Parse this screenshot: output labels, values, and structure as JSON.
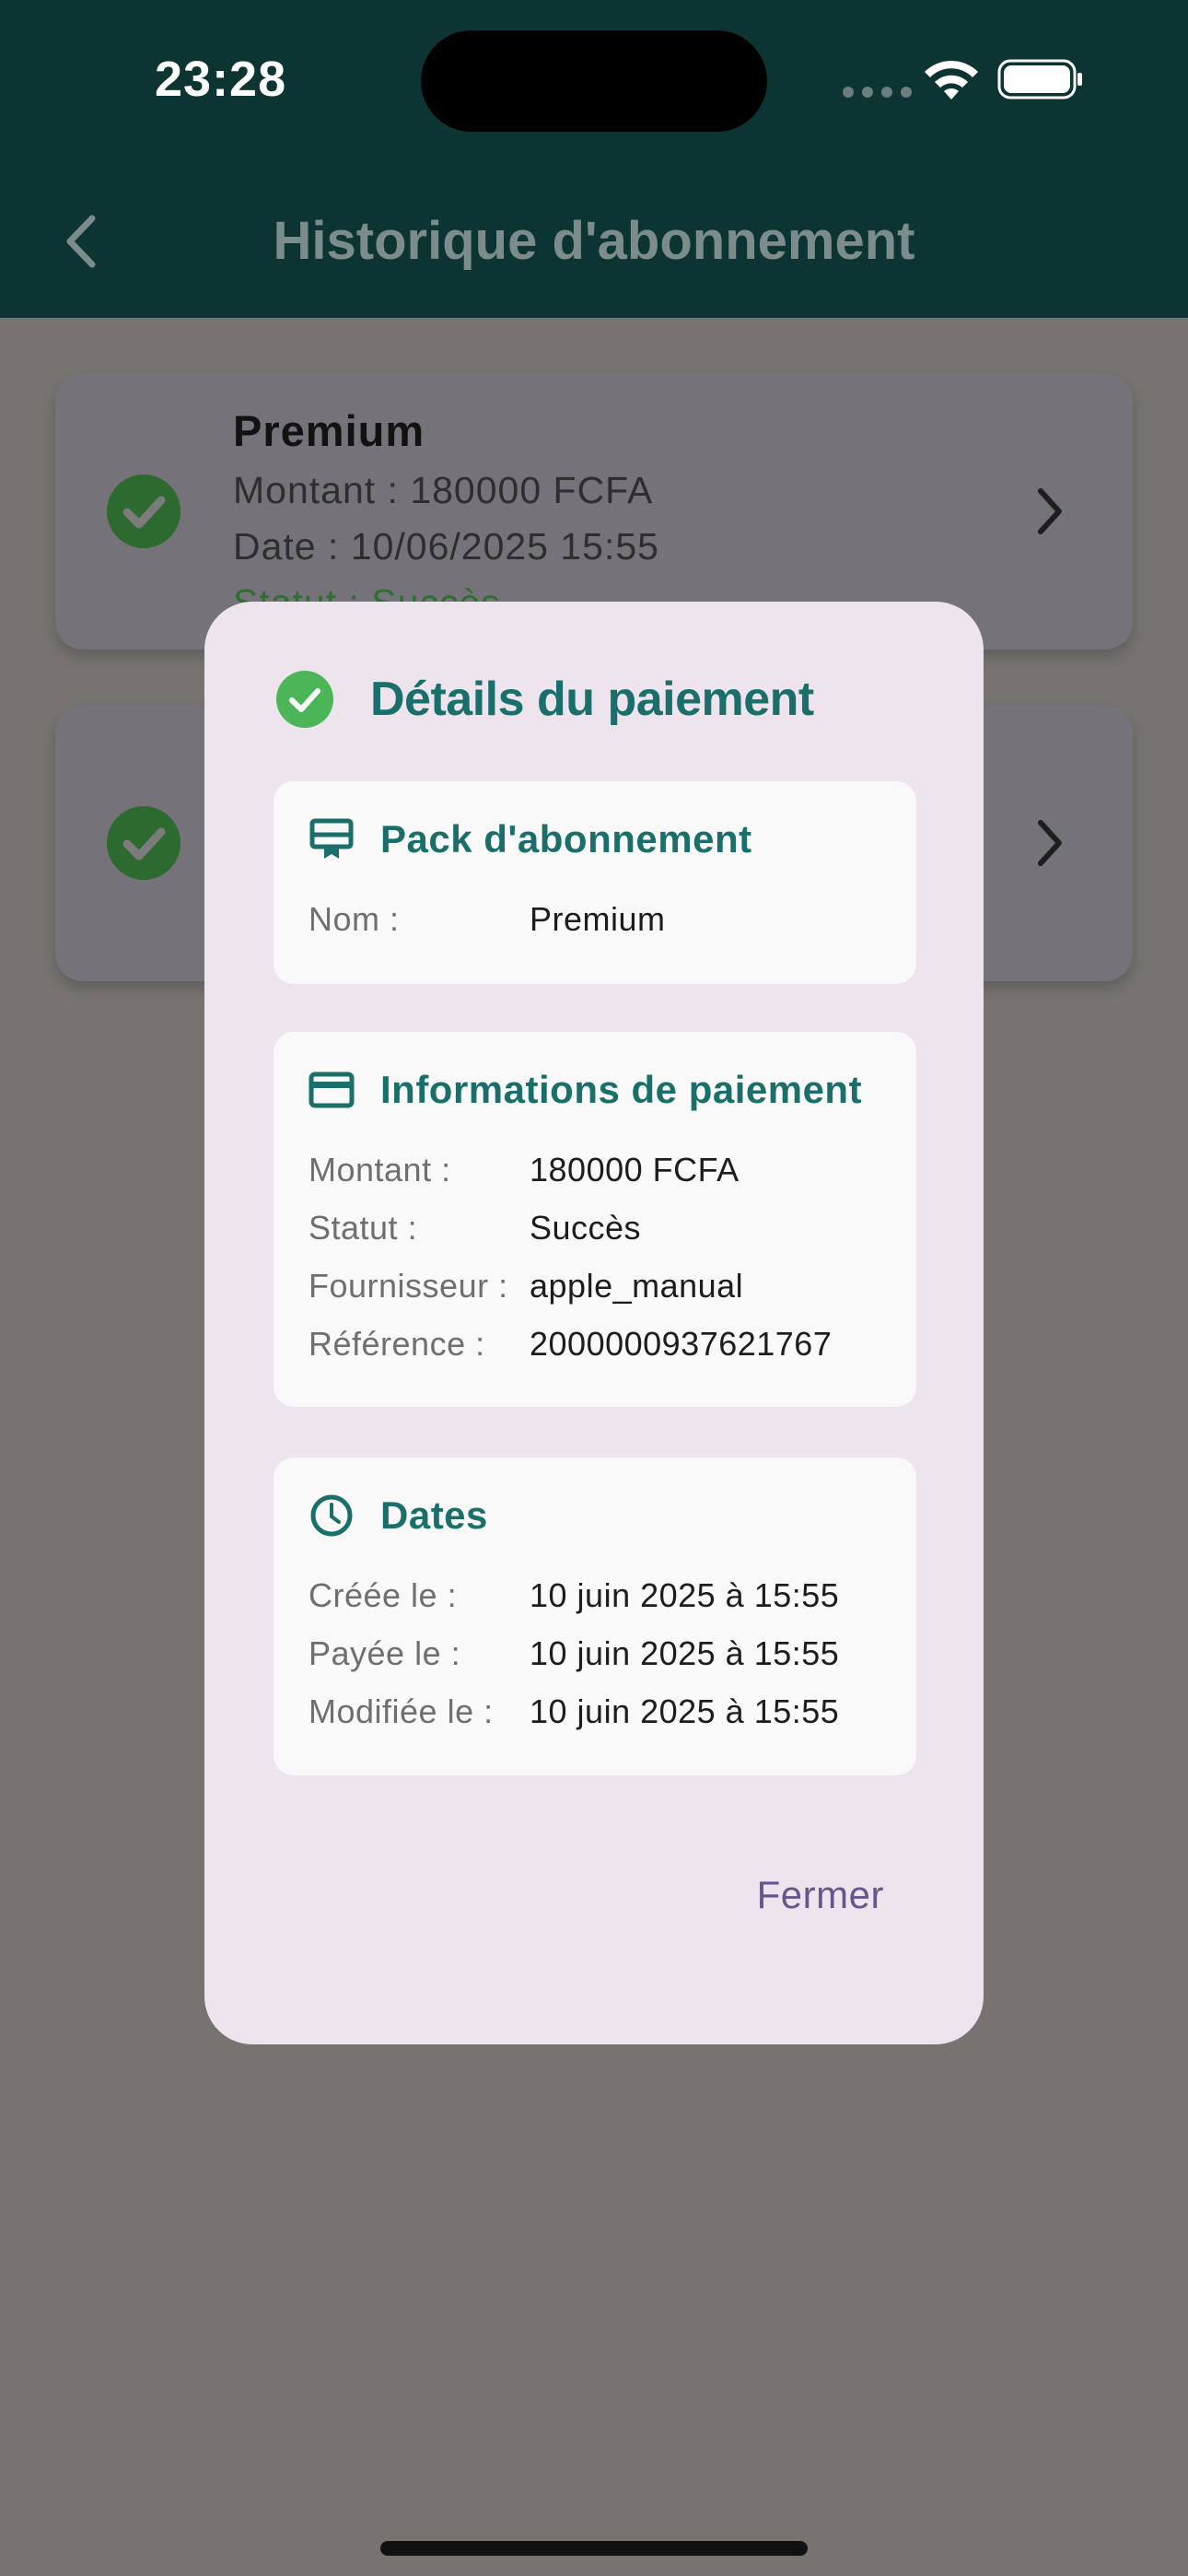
{
  "status_bar": {
    "time": "23:28"
  },
  "header": {
    "title": "Historique d'abonnement"
  },
  "history": [
    {
      "title": "Premium",
      "amount": "Montant : 180000 FCFA",
      "date": "Date : 10/06/2025 15:55",
      "status": "Statut : Succès"
    },
    {
      "title": "",
      "amount": "",
      "date": "",
      "status": ""
    }
  ],
  "dialog": {
    "title": "Détails du paiement",
    "pack": {
      "title": "Pack d'abonnement",
      "rows": [
        {
          "label": "Nom :",
          "value": "Premium"
        }
      ]
    },
    "payment": {
      "title": "Informations de paiement",
      "rows": [
        {
          "label": "Montant :",
          "value": "180000 FCFA"
        },
        {
          "label": "Statut :",
          "value": "Succès"
        },
        {
          "label": "Fournisseur :",
          "value": "apple_manual"
        },
        {
          "label": "Référence :",
          "value": "2000000937621767"
        }
      ]
    },
    "dates": {
      "title": "Dates",
      "rows": [
        {
          "label": "Créée le :",
          "value": "10 juin 2025 à 15:55"
        },
        {
          "label": "Payée le :",
          "value": "10 juin 2025 à 15:55"
        },
        {
          "label": "Modifiée le :",
          "value": "10 juin 2025 à 15:55"
        }
      ]
    },
    "close_label": "Fermer"
  },
  "colors": {
    "accent": "#1a6f6b",
    "success": "#4bb558",
    "dialog_bg": "#ede4ee",
    "header_bg": "#0b3432"
  }
}
